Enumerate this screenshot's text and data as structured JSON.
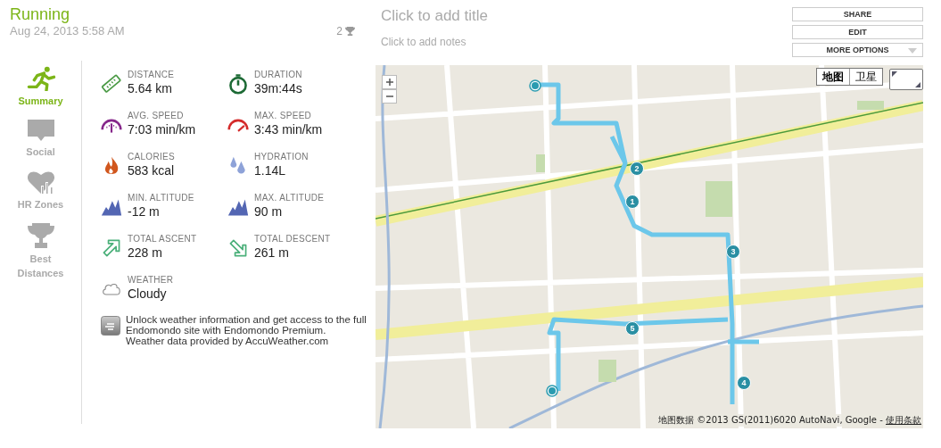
{
  "header": {
    "sport": "Running",
    "date": "Aug 24, 2013 5:58 AM",
    "trophies": "2",
    "title_placeholder": "Click to add title",
    "notes_placeholder": "Click to add notes"
  },
  "actions": [
    "SHARE",
    "EDIT",
    "MORE OPTIONS"
  ],
  "nav": [
    {
      "kind": "summary",
      "label": "Summary",
      "selected": true
    },
    {
      "kind": "social",
      "label": "Social",
      "selected": false
    },
    {
      "kind": "hr",
      "label": "HR Zones",
      "selected": false
    },
    {
      "kind": "best",
      "label": "Best Distances",
      "selected": false
    }
  ],
  "stats": [
    {
      "kind": "distance",
      "label": "DISTANCE",
      "value": "5.64 km"
    },
    {
      "kind": "duration",
      "label": "DURATION",
      "value": "39m:44s"
    },
    {
      "kind": "avg_speed",
      "label": "AVG. SPEED",
      "value": "7:03 min/km"
    },
    {
      "kind": "max_speed",
      "label": "MAX. SPEED",
      "value": "3:43 min/km"
    },
    {
      "kind": "calories",
      "label": "CALORIES",
      "value": "583 kcal"
    },
    {
      "kind": "hydration",
      "label": "HYDRATION",
      "value": "1.14L"
    },
    {
      "kind": "min_altitude",
      "label": "MIN. ALTITUDE",
      "value": "-12 m"
    },
    {
      "kind": "max_altitude",
      "label": "MAX. ALTITUDE",
      "value": "90 m"
    },
    {
      "kind": "ascent",
      "label": "TOTAL ASCENT",
      "value": "228 m"
    },
    {
      "kind": "descent",
      "label": "TOTAL DESCENT",
      "value": "261 m"
    },
    {
      "kind": "weather",
      "label": "WEATHER",
      "value": "Cloudy"
    }
  ],
  "premium": {
    "text": "Unlock weather information and get access to the full Endomondo site with Endomondo Premium.",
    "credit": "Weather data provided by AccuWeather.com"
  },
  "map": {
    "map_types": [
      {
        "label": "地图",
        "selected": true
      },
      {
        "label": "卫星",
        "selected": false
      }
    ],
    "laps": [
      "1",
      "2",
      "3",
      "4",
      "5"
    ],
    "attribution": "地图数据 ©2013 GS(2011)6020 AutoNavi, Google - ",
    "terms": "使用条款"
  }
}
